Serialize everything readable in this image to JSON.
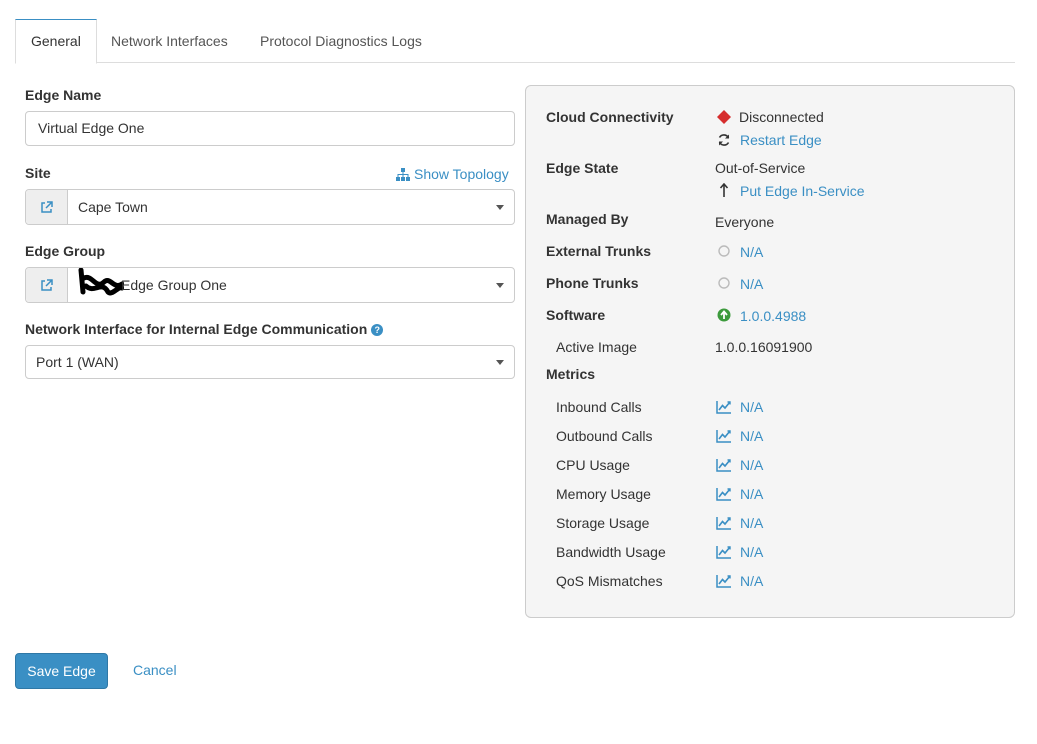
{
  "tabs": [
    {
      "label": "General",
      "active": true
    },
    {
      "label": "Network Interfaces",
      "active": false
    },
    {
      "label": "Protocol Diagnostics Logs",
      "active": false
    }
  ],
  "form": {
    "edge_name_label": "Edge Name",
    "edge_name_value": "Virtual Edge One",
    "site_label": "Site",
    "show_topology": "Show Topology",
    "site_value": "Cape Town",
    "edge_group_label": "Edge Group",
    "edge_group_value": "Edge Group One",
    "network_interface_label": "Network Interface for Internal Edge Communication",
    "network_interface_value": "Port 1 (WAN)"
  },
  "status": {
    "cloud_connectivity_label": "Cloud Connectivity",
    "cloud_connectivity_value": "Disconnected",
    "restart_edge": "Restart Edge",
    "edge_state_label": "Edge State",
    "edge_state_value": "Out-of-Service",
    "put_in_service": "Put Edge In-Service",
    "managed_by_label": "Managed By",
    "managed_by_value": "Everyone",
    "external_trunks_label": "External Trunks",
    "external_trunks_value": "N/A",
    "phone_trunks_label": "Phone Trunks",
    "phone_trunks_value": "N/A",
    "software_label": "Software",
    "software_value": "1.0.0.4988",
    "active_image_label": "Active Image",
    "active_image_value": "1.0.0.16091900",
    "metrics_label": "Metrics",
    "metrics": [
      {
        "label": "Inbound Calls",
        "value": "N/A"
      },
      {
        "label": "Outbound Calls",
        "value": "N/A"
      },
      {
        "label": "CPU Usage",
        "value": "N/A"
      },
      {
        "label": "Memory Usage",
        "value": "N/A"
      },
      {
        "label": "Storage Usage",
        "value": "N/A"
      },
      {
        "label": "Bandwidth Usage",
        "value": "N/A"
      },
      {
        "label": "QoS Mismatches",
        "value": "N/A"
      }
    ]
  },
  "actions": {
    "save_label": "Save Edge",
    "cancel_label": "Cancel"
  },
  "colors": {
    "accent": "#3a8fc4",
    "disconnected": "#d62d2d",
    "software_ok": "#3c9a3c"
  },
  "icons": {
    "disconnected": "diamond-icon",
    "restart": "refresh-icon",
    "put_in_service": "arrow-up-icon",
    "trunk_status": "circle-outline-icon",
    "software": "circle-arrow-up-icon",
    "metric": "line-chart-icon",
    "external_link": "external-link-icon",
    "topology": "sitemap-icon",
    "help": "question-circle-icon"
  }
}
